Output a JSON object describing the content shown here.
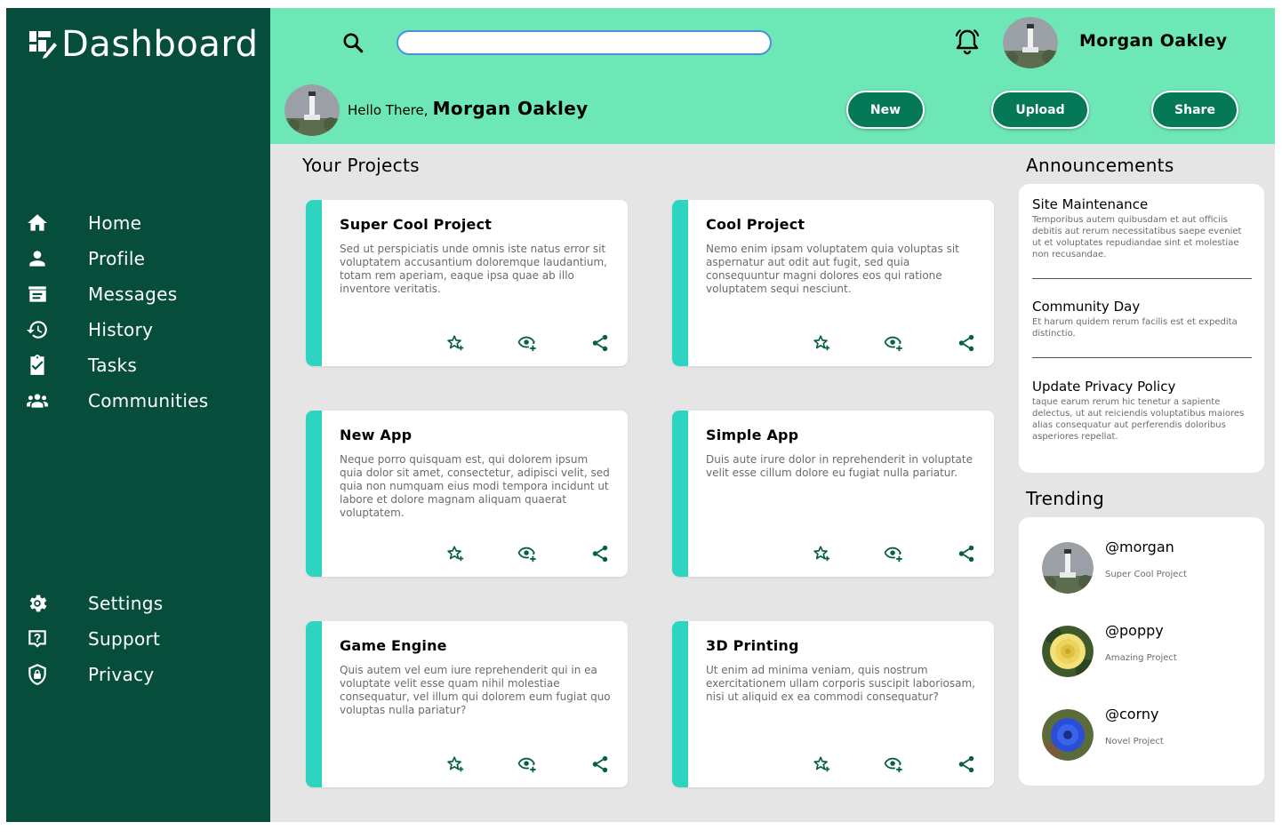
{
  "app": {
    "title": "Dashboard"
  },
  "colors": {
    "sidebar": "#064e3b",
    "header": "#6ee7b7",
    "accent": "#2dd4bf",
    "button": "#047857",
    "background": "#e5e5e5"
  },
  "sidebar": {
    "items": [
      {
        "label": "Home",
        "icon": "home-icon"
      },
      {
        "label": "Profile",
        "icon": "person-icon"
      },
      {
        "label": "Messages",
        "icon": "messages-icon"
      },
      {
        "label": "History",
        "icon": "history-icon"
      },
      {
        "label": "Tasks",
        "icon": "clipboard-check-icon"
      },
      {
        "label": "Communities",
        "icon": "group-icon"
      }
    ],
    "bottom_items": [
      {
        "label": "Settings",
        "icon": "gear-icon"
      },
      {
        "label": "Support",
        "icon": "question-icon"
      },
      {
        "label": "Privacy",
        "icon": "shield-lock-icon"
      }
    ]
  },
  "header": {
    "search": {
      "value": "",
      "placeholder": ""
    },
    "user_name": "Morgan Oakley",
    "greeting_prefix": "Hello There,",
    "greeting_name": "Morgan Oakley",
    "buttons": {
      "new": "New",
      "upload": "Upload",
      "share": "Share"
    }
  },
  "projects": {
    "title": "Your Projects",
    "cards": [
      {
        "title": "Super Cool Project",
        "description": "Sed ut perspiciatis unde omnis iste natus error sit voluptatem accusantium doloremque laudantium, totam rem aperiam, eaque ipsa quae ab illo inventore veritatis."
      },
      {
        "title": "Cool Project",
        "description": "Nemo enim ipsam voluptatem quia voluptas sit aspernatur aut odit aut fugit, sed quia consequuntur magni dolores eos qui ratione voluptatem sequi nesciunt."
      },
      {
        "title": "New App",
        "description": "Neque porro quisquam est, qui dolorem ipsum quia dolor sit amet, consectetur, adipisci velit, sed quia non numquam eius modi tempora incidunt ut labore et dolore magnam aliquam quaerat voluptatem."
      },
      {
        "title": "Simple App",
        "description": "Duis aute irure dolor in reprehenderit in voluptate velit esse cillum dolore eu fugiat nulla pariatur."
      },
      {
        "title": "Game Engine",
        "description": "Quis autem vel eum iure reprehenderit qui in ea voluptate velit esse quam nihil molestiae consequatur, vel illum qui dolorem eum fugiat quo voluptas nulla pariatur?"
      },
      {
        "title": "3D Printing",
        "description": "Ut enim ad minima veniam, quis nostrum exercitationem ullam corporis suscipit laboriosam, nisi ut aliquid ex ea commodi consequatur?"
      }
    ]
  },
  "announcements": {
    "title": "Announcements",
    "items": [
      {
        "title": "Site Maintenance",
        "body": "Temporibus autem quibusdam et aut officiis debitis aut rerum necessitatibus saepe eveniet ut et voluptates repudiandae sint et molestiae non recusandae."
      },
      {
        "title": "Community Day",
        "body": "Et harum quidem rerum facilis est et expedita distinctio."
      },
      {
        "title": "Update Privacy Policy",
        "body": "taque earum rerum hic tenetur a sapiente delectus, ut aut reiciendis voluptatibus maiores alias consequatur aut perferendis doloribus asperiores repellat."
      }
    ]
  },
  "trending": {
    "title": "Trending",
    "items": [
      {
        "handle": "@morgan",
        "project": "Super Cool Project"
      },
      {
        "handle": "@poppy",
        "project": "Amazing Project"
      },
      {
        "handle": "@corny",
        "project": "Novel Project"
      }
    ]
  }
}
